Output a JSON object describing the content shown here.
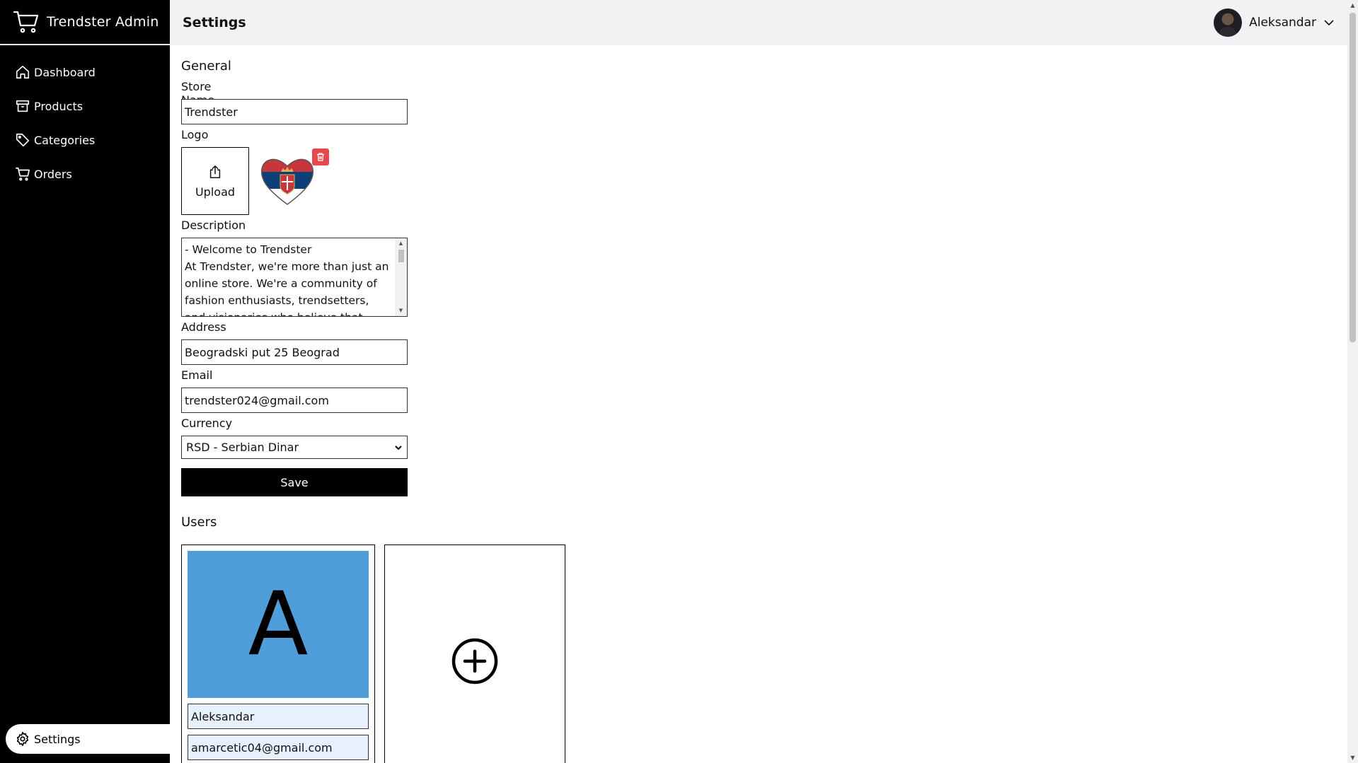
{
  "app": {
    "title": "Trendster Admin"
  },
  "sidebar": {
    "items": [
      {
        "label": "Dashboard",
        "icon": "home-icon"
      },
      {
        "label": "Products",
        "icon": "archive-icon"
      },
      {
        "label": "Categories",
        "icon": "tag-icon"
      },
      {
        "label": "Orders",
        "icon": "cart-icon"
      }
    ],
    "settings": {
      "label": "Settings",
      "icon": "gear-icon",
      "active": true
    }
  },
  "header": {
    "title": "Settings",
    "user": {
      "name": "Aleksandar"
    }
  },
  "general": {
    "title": "General",
    "store_name": {
      "label": "Store Name",
      "value": "Trendster"
    },
    "logo": {
      "label": "Logo",
      "upload_label": "Upload"
    },
    "description": {
      "label": "Description",
      "value": "- Welcome to Trendster\nAt Trendster, we're more than just an online store. We're a community of fashion enthusiasts, trendsetters,\nand visionaries who believe that"
    },
    "address": {
      "label": "Address",
      "value": "Beogradski put 25 Beograd"
    },
    "email": {
      "label": "Email",
      "value": "trendster024@gmail.com"
    },
    "currency": {
      "label": "Currency",
      "value": "RSD - Serbian Dinar"
    },
    "save_label": "Save"
  },
  "users": {
    "title": "Users",
    "list": [
      {
        "initial": "A",
        "name": "Aleksandar",
        "email": "amarcetic04@gmail.com",
        "avatar_color": "#509ed9"
      }
    ]
  },
  "colors": {
    "sidebar_bg": "#000000",
    "accent_delete": "#e5484d",
    "avatar_bg": "#509ed9"
  }
}
